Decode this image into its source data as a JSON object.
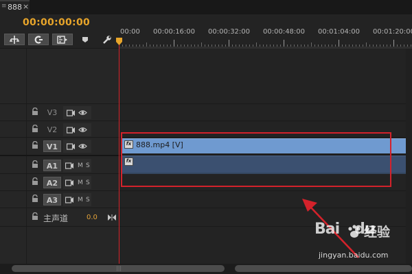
{
  "tab": {
    "title": "888",
    "close_glyph": "×",
    "menu_icon": "panel-menu-icon"
  },
  "timecode": "00:00:00:00",
  "toolbar": {
    "icons": [
      "snap-icon",
      "linked-selection-icon",
      "add-marker-icon",
      "marker-icon",
      "wrench-icon"
    ]
  },
  "ruler": {
    "labels": [
      "00:00",
      "00:00:16:00",
      "00:00:32:00",
      "00:00:48:00",
      "00:01:04:00",
      "00:01:20:00"
    ]
  },
  "tracks": {
    "video": [
      {
        "name": "V3",
        "targeted": false
      },
      {
        "name": "V2",
        "targeted": false
      },
      {
        "name": "V1",
        "targeted": true
      }
    ],
    "audio": [
      {
        "name": "A1",
        "mute": "M",
        "solo": "S"
      },
      {
        "name": "A2",
        "mute": "M",
        "solo": "S"
      },
      {
        "name": "A3",
        "mute": "M",
        "solo": "S"
      }
    ],
    "master": {
      "name": "主声道",
      "value": "0.0"
    }
  },
  "clips": {
    "video_clip": {
      "label": "888.mp4 [V]",
      "fx": "fx",
      "color": "#6f9ad0"
    },
    "audio_clip": {
      "fx": "fx",
      "color": "#3b5070"
    }
  },
  "colors": {
    "timecode": "#e8a52a",
    "playhead": "#d9242b",
    "annotation": "#d4222b"
  },
  "watermark": {
    "logo": "Bai",
    "logo_suffix": "du",
    "cn": "经验",
    "url": "jingyan.baidu.com"
  }
}
